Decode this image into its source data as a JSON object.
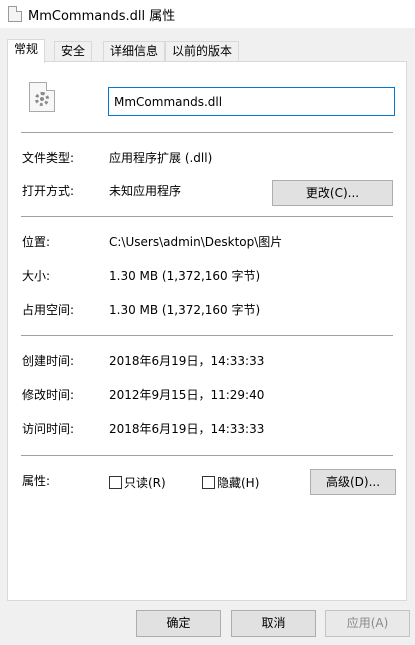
{
  "window": {
    "title": "MmCommands.dll 属性"
  },
  "tabs": [
    {
      "label": "常规"
    },
    {
      "label": "安全"
    },
    {
      "label": "详细信息"
    },
    {
      "label": "以前的版本"
    }
  ],
  "general": {
    "file_name": "MmCommands.dll",
    "file_type_label": "文件类型:",
    "file_type_value": "应用程序扩展 (.dll)",
    "opens_with_label": "打开方式:",
    "opens_with_value": "未知应用程序",
    "change_button": "更改(C)...",
    "location_label": "位置:",
    "location_value": "C:\\Users\\admin\\Desktop\\图片",
    "size_label": "大小:",
    "size_value": "1.30 MB (1,372,160 字节)",
    "size_on_disk_label": "占用空间:",
    "size_on_disk_value": "1.30 MB (1,372,160 字节)",
    "created_label": "创建时间:",
    "created_value": "2018年6月19日，14:33:33",
    "modified_label": "修改时间:",
    "modified_value": "2012年9月15日，11:29:40",
    "accessed_label": "访问时间:",
    "accessed_value": "2018年6月19日，14:33:33",
    "attributes_label": "属性:",
    "readonly_label": "只读(R)",
    "readonly_checked": false,
    "hidden_label": "隐藏(H)",
    "hidden_checked": false,
    "advanced_button": "高级(D)..."
  },
  "footer": {
    "ok": "确定",
    "cancel": "取消",
    "apply": "应用(A)"
  },
  "icons": {
    "window": "dll-file-icon",
    "file": "dll-gear-file-icon"
  }
}
